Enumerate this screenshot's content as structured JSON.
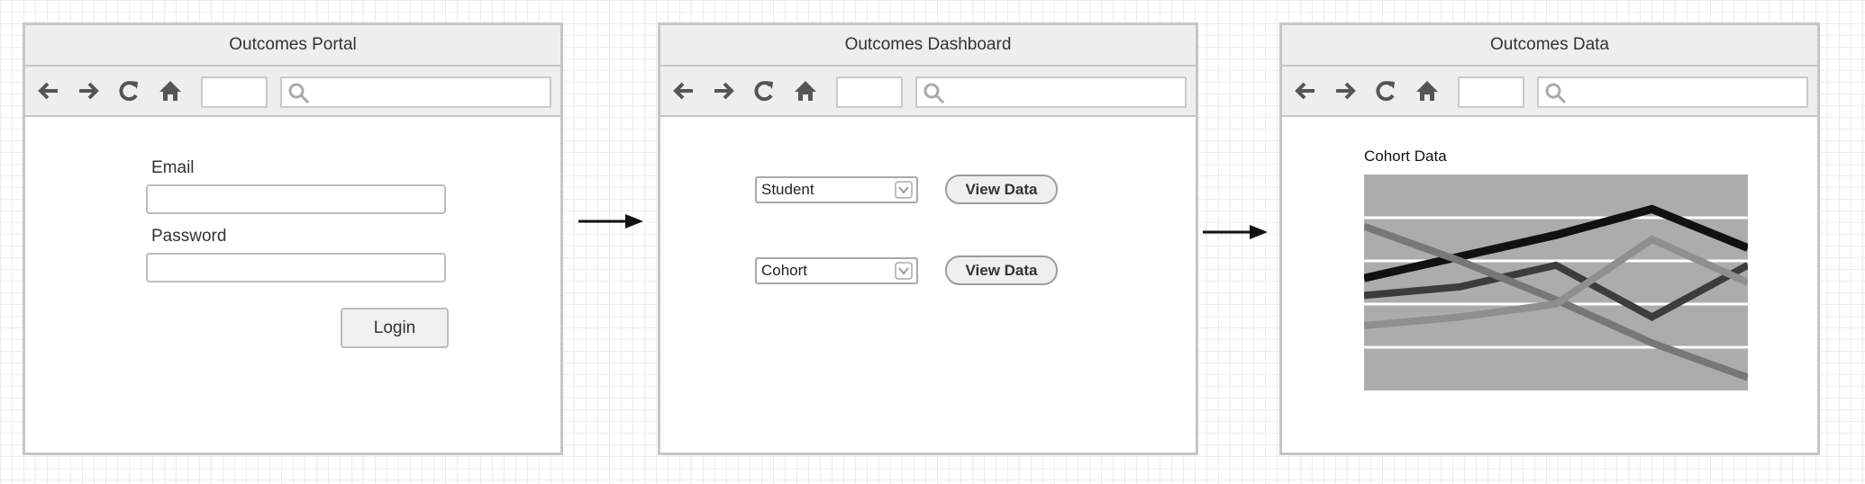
{
  "windows": [
    {
      "title": "Outcomes Portal"
    },
    {
      "title": "Outcomes Dashboard"
    },
    {
      "title": "Outcomes Data"
    }
  ],
  "toolbar_icons": [
    "back-arrow-icon",
    "forward-arrow-icon",
    "reload-icon",
    "home-icon",
    "search-icon"
  ],
  "login": {
    "email_label": "Email",
    "email_value": "",
    "password_label": "Password",
    "password_value": "",
    "login_button": "Login"
  },
  "dashboard": {
    "rows": [
      {
        "select_value": "Student",
        "button_label": "View Data"
      },
      {
        "select_value": "Cohort",
        "button_label": "View Data"
      }
    ]
  },
  "data_page": {
    "chart_title": "Cohort Data"
  },
  "colors": {
    "chart_background": "#acacac",
    "grid_lines": "#ffffff",
    "window_border": "#c6c6c6",
    "titlebar": "#eeeeee"
  },
  "chart_data": {
    "type": "line",
    "title": "Cohort Data",
    "xlabel": "",
    "ylabel": "",
    "x": [
      0,
      1,
      2,
      3,
      4
    ],
    "ylim": [
      0,
      5
    ],
    "grid": true,
    "legend": "none",
    "series": [
      {
        "color": "#111111",
        "width": 9,
        "values": [
          2.6,
          3.1,
          3.6,
          4.2,
          3.3
        ]
      },
      {
        "color": "#3c3c3c",
        "width": 8,
        "values": [
          2.2,
          2.4,
          2.9,
          1.7,
          2.9
        ]
      },
      {
        "color": "#777777",
        "width": 8,
        "values": [
          3.8,
          3.0,
          2.1,
          1.1,
          0.3
        ]
      },
      {
        "color": "#8f8f8f",
        "width": 8,
        "values": [
          1.5,
          1.7,
          2.0,
          3.5,
          2.5
        ]
      }
    ]
  }
}
